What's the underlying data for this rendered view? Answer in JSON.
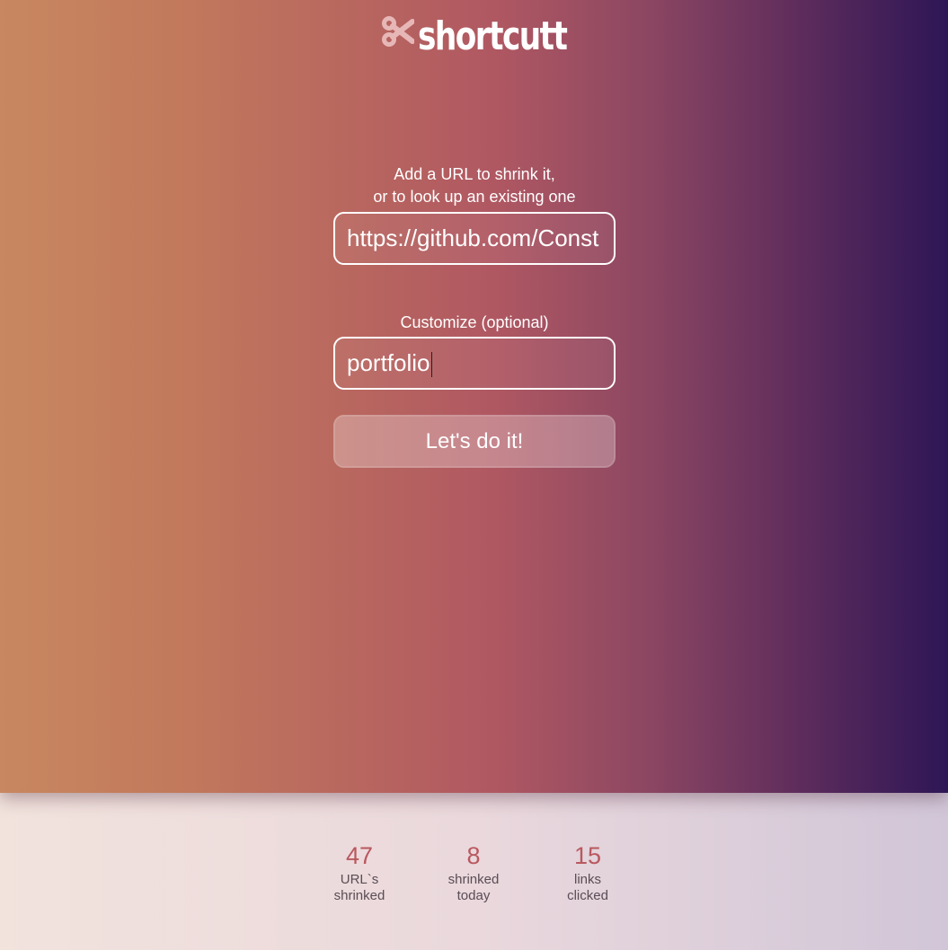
{
  "brand": {
    "name": "shortcutt",
    "icon": "scissors-icon"
  },
  "form": {
    "url_label_line1": "Add a URL to shrink it,",
    "url_label_line2": "or to look up an existing one",
    "url_value": "https://github.com/Const",
    "custom_label": "Customize (optional)",
    "custom_value": "portfolio",
    "submit_label": "Let's do it!"
  },
  "stats": [
    {
      "value": "47",
      "label_line1": "URL`s",
      "label_line2": "shrinked"
    },
    {
      "value": "8",
      "label_line1": "shrinked",
      "label_line2": "today"
    },
    {
      "value": "15",
      "label_line1": "links",
      "label_line2": "clicked"
    }
  ],
  "colors": {
    "gradient_start": "#c88760",
    "gradient_end": "#2e1656",
    "stat_value": "#b9585f"
  }
}
